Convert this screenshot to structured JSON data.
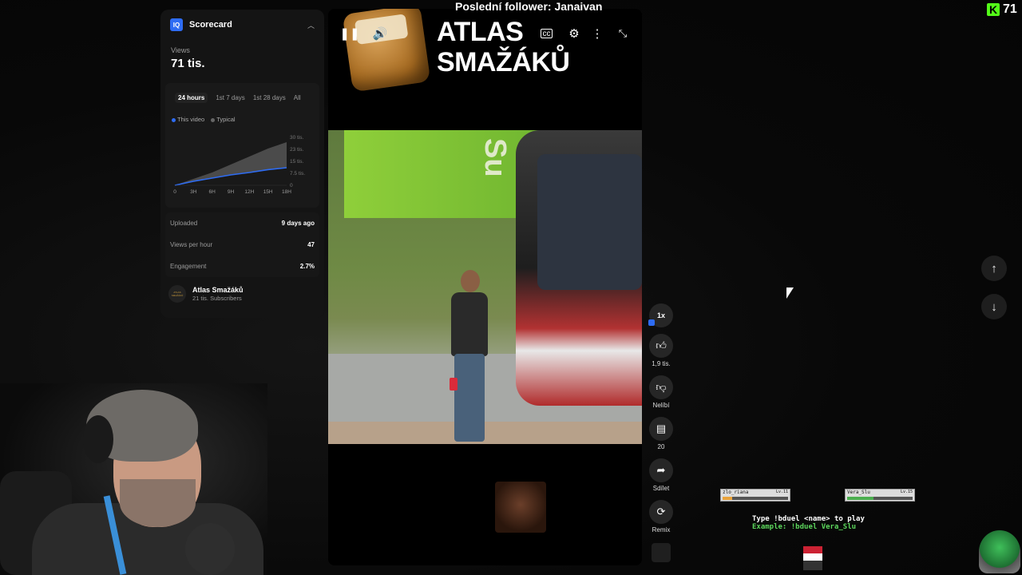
{
  "follower_banner": "Poslední follower: Janaivan",
  "kick": {
    "count": "71"
  },
  "scorecard": {
    "title": "Scorecard",
    "views_label": "Views",
    "views_value": "71 tis.",
    "tabs": [
      "24 hours",
      "1st 7 days",
      "1st 28 days",
      "All"
    ],
    "legend": {
      "this_video": "This video",
      "typical": "Typical"
    },
    "stats": [
      {
        "label": "Uploaded",
        "value": "9 days ago"
      },
      {
        "label": "Views per hour",
        "value": "47"
      },
      {
        "label": "Engagement",
        "value": "2.7%"
      }
    ],
    "channel": {
      "name": "Atlas Smažáků",
      "subscribers": "21 tis. Subscribers",
      "avatar_text": "ATLAS SMAŽÁKŮ"
    },
    "chart_data": {
      "type": "area",
      "x": [
        "0",
        "3H",
        "6H",
        "9H",
        "12H",
        "15H",
        "18H"
      ],
      "y_ticks": [
        "30 tis.",
        "23 tis.",
        "15 tis.",
        "7.5 tis.",
        "0"
      ],
      "ylim": [
        0,
        30000
      ],
      "series": [
        {
          "name": "This video",
          "values": [
            0,
            2500,
            4500,
            6500,
            8000,
            9800,
            11000
          ]
        },
        {
          "name": "Typical",
          "values": [
            0,
            4000,
            8000,
            13000,
            18000,
            23000,
            27000
          ]
        }
      ],
      "colors": {
        "this_video": "#2e6cf3",
        "typical": "#555555"
      }
    }
  },
  "video": {
    "brand_title_line1": "ATLAS",
    "brand_title_line2": "SMAŽÁKŮ",
    "banner_text": "Su",
    "controls": [
      "pause-icon",
      "volume-icon",
      "captions-icon",
      "settings-icon",
      "more-icon",
      "collapse-icon"
    ]
  },
  "actions": {
    "speed": "1x",
    "likes": "1,9 tis.",
    "dislike_label": "Nelíbí",
    "comments": "20",
    "share_label": "Sdílet",
    "remix_label": "Remix"
  },
  "duel": {
    "player1": {
      "name": "zlo_riana",
      "level": "Lv.11",
      "hp": 0.15
    },
    "player2": {
      "name": "Vera_Slu",
      "level": "Lv.15",
      "hp": 0.4
    },
    "line1": "Type !bduel <name> to play",
    "line2": "Example: !bduel Vera_Slu"
  }
}
